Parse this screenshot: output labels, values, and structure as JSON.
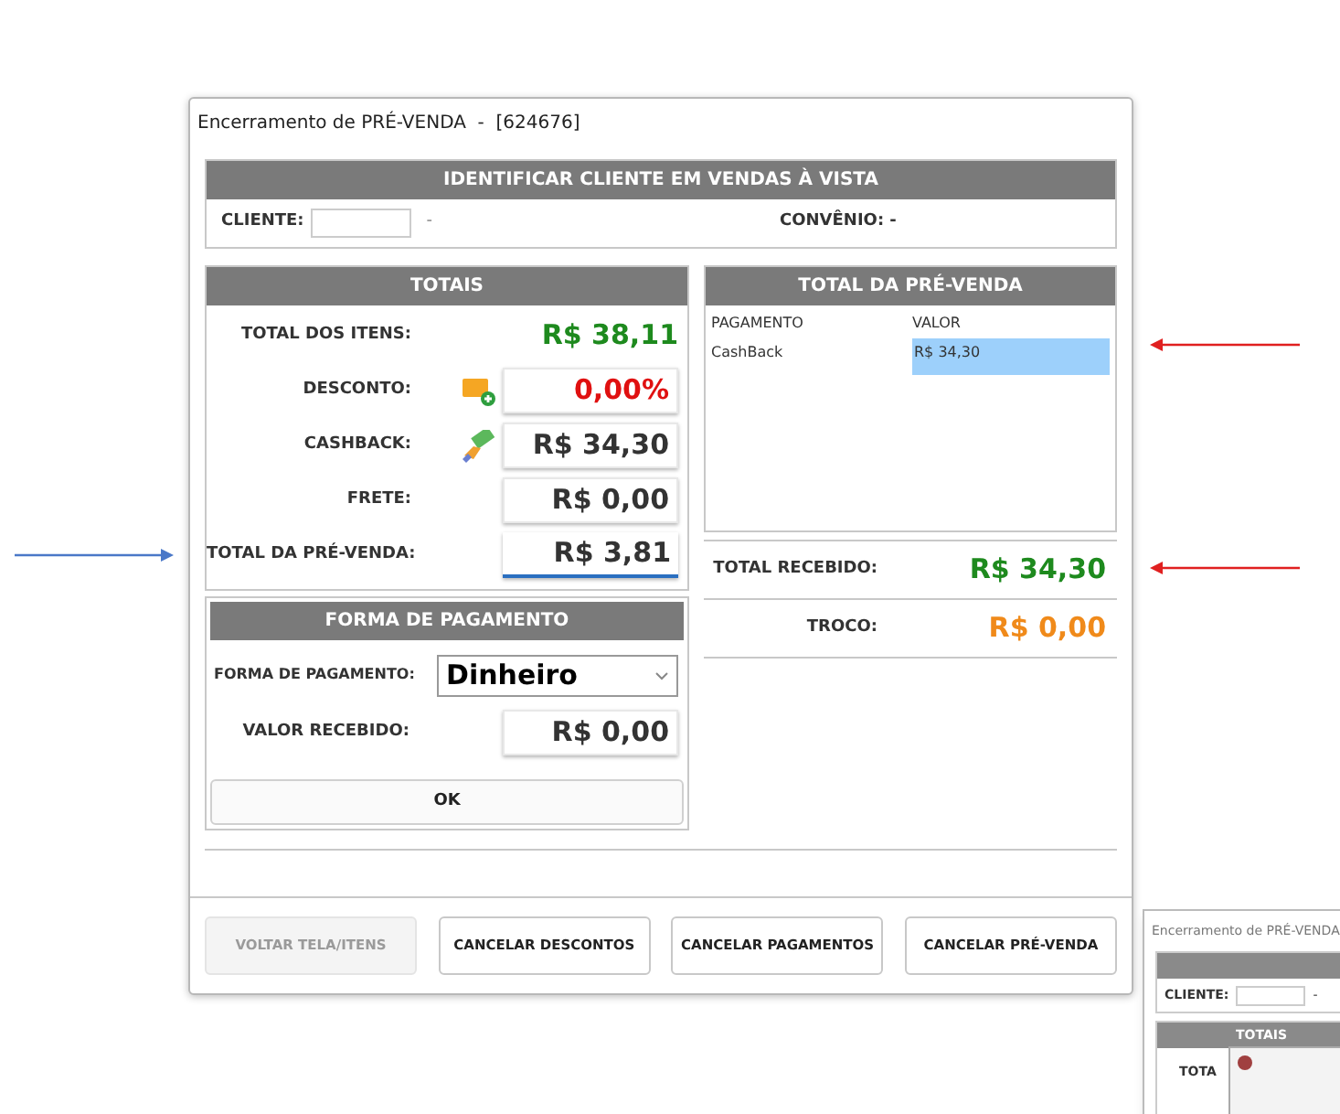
{
  "window": {
    "title": "Encerramento de PRÉ-VENDA  -  [624676]"
  },
  "client_section": {
    "title": "IDENTIFICAR CLIENTE EM VENDAS À VISTA",
    "client_label": "CLIENTE:",
    "client_name": "-",
    "agreement": "CONVÊNIO: -"
  },
  "totals": {
    "title": "TOTAIS",
    "rows": [
      {
        "kind": "plain",
        "label": "TOTAL DOS ITENS:",
        "value": "R$ 38,11",
        "color": "#1e8a1e"
      },
      {
        "kind": "discount",
        "label": "DESCONTO:",
        "value": "0,00%",
        "color": "#e01010",
        "focused": false
      },
      {
        "kind": "cashback",
        "label": "CASHBACK:",
        "value": "R$ 34,30",
        "color": "#333333",
        "focused": false
      },
      {
        "kind": "field",
        "label": "FRETE:",
        "value": "R$ 0,00",
        "color": "#333333",
        "focused": false
      },
      {
        "kind": "field",
        "label": "TOTAL DA PRÉ-VENDA:",
        "value": "R$ 3,81",
        "color": "#333333",
        "focused": true
      }
    ]
  },
  "payment": {
    "title": "FORMA DE PAGAMENTO",
    "method_label": "FORMA DE PAGAMENTO:",
    "method_value": "Dinheiro",
    "received_label": "VALOR RECEBIDO:",
    "received_value": "R$ 0,00",
    "ok": "OK"
  },
  "summary": {
    "title": "TOTAL DA PRÉ-VENDA",
    "columns": [
      "PAGAMENTO",
      "VALOR"
    ],
    "rows": [
      {
        "cells": [
          "CashBack",
          "R$ 34,30"
        ],
        "selected": true
      }
    ],
    "totals": [
      {
        "label": "TOTAL RECEBIDO:",
        "value": "R$ 34,30",
        "color": "#1e8a1e"
      },
      {
        "label": "TROCO:",
        "value": "R$ 0,00",
        "color": "#f08a1a"
      }
    ]
  },
  "buttons": [
    {
      "label": "VOLTAR TELA/ITENS",
      "disabled": true
    },
    {
      "label": "CANCELAR DESCONTOS",
      "disabled": false
    },
    {
      "label": "CANCELAR PAGAMENTOS",
      "disabled": false
    },
    {
      "label": "CANCELAR PRÉ-VENDA",
      "disabled": false
    }
  ],
  "background_window": {
    "title": "Encerramento de PRÉ-VENDA",
    "client_label": "CLIENTE:",
    "client_name": "-",
    "section_title": "TOTAIS",
    "row_label": "TOTA"
  }
}
